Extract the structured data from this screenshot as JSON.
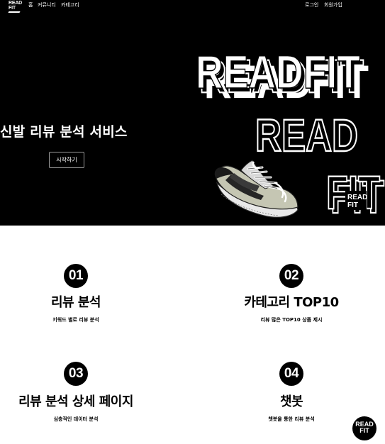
{
  "nav": {
    "logo_line1": "READ",
    "logo_line2": "FIT",
    "home": "홈",
    "community": "커뮤니티",
    "category": "카테고리",
    "login": "로그인",
    "signup": "회원가입"
  },
  "hero": {
    "title": "신발 리뷰 분석 서비스",
    "start_button": "시작하기",
    "brand_word_full": "READFIT",
    "brand_word_read": "READ",
    "brand_word_fit": "FIT",
    "badge_line1": "READ",
    "badge_line2": "FIT"
  },
  "features": [
    {
      "number": "01",
      "title": "리뷰 분석",
      "desc": "키워드 별로 리뷰 분석"
    },
    {
      "number": "02",
      "title": "카테고리 TOP10",
      "desc": "리뷰 많은 TOP10 상품 제시"
    },
    {
      "number": "03",
      "title": "리뷰 분석 상세 페이지",
      "desc": "심층적인 데이터 분석"
    },
    {
      "number": "04",
      "title": "챗봇",
      "desc": "챗봇을 통한 리뷰 분석"
    }
  ],
  "corner_logo": {
    "line1": "READ",
    "line2": "FIT"
  },
  "colors": {
    "hero_bg": "#000000",
    "text_on_dark": "#ffffff",
    "page_bg": "#ffffff",
    "accent": "#000000"
  },
  "icons": {
    "shoe": "sneaker-illustration",
    "chat": "chatbot-logo"
  }
}
